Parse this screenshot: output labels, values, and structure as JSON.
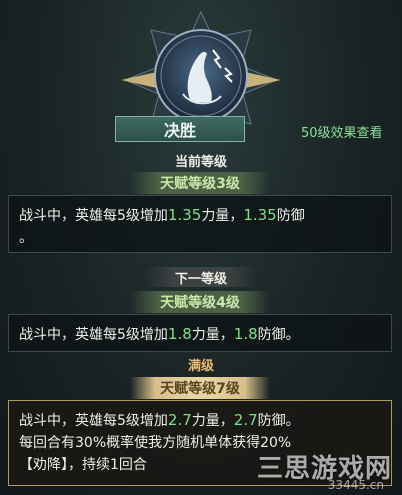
{
  "skill": {
    "name": "决胜",
    "view_link": "50级效果查看",
    "icon": "lightning-skill-icon"
  },
  "current": {
    "section": "当前等级",
    "level_tab": "天赋等级3级",
    "text_prefix": "战斗中，英雄每5级增加",
    "attack_value": "1.35",
    "text_mid": "力量，",
    "defense_value": "1.35",
    "text_suffix": "防御",
    "text_wrap": "。"
  },
  "next": {
    "section": "下一等级",
    "level_tab": "天赋等级4级",
    "text_prefix": "战斗中，英雄每5级增加",
    "attack_value": "1.8",
    "text_mid": "力量，",
    "defense_value": "1.8",
    "text_suffix": "防御。"
  },
  "max": {
    "section": "满级",
    "level_tab": "天赋等级7级",
    "text_prefix": "战斗中，英雄每5级增加",
    "attack_value": "2.7",
    "text_mid": "力量，",
    "defense_value": "2.7",
    "text_suffix": "防御。",
    "line2": "每回合有30%概率使我方随机单体获得20%",
    "line3": "【劝降】，持续1回合"
  },
  "watermark": {
    "title": "三思游戏网",
    "url": "33445.cn"
  },
  "colors": {
    "value_green": "#7ee08a",
    "link_green": "#8ee09a",
    "max_label": "#e7b974"
  }
}
